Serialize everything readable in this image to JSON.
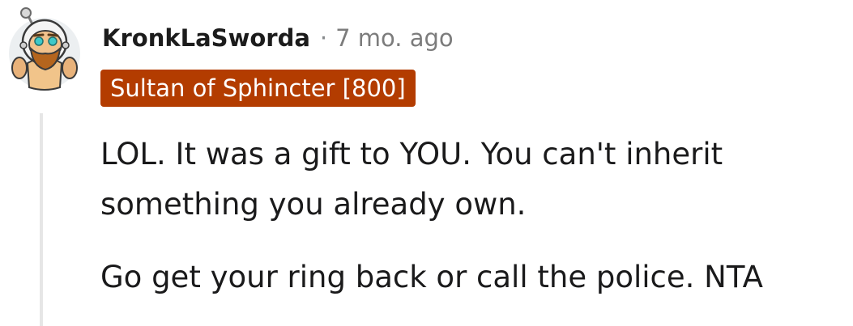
{
  "comment": {
    "author": "KronkLaSworda",
    "separator": "·",
    "timestamp": "7 mo. ago",
    "flair": "Sultan of Sphincter [800]",
    "paragraphs": [
      "LOL. It was a gift to YOU. You can't inherit something you already own.",
      "Go get your ring back or call the police. NTA"
    ],
    "avatar_icon": "snoo-astronaut-avatar-icon",
    "colors": {
      "flair_background": "#b33c00",
      "flair_text": "#ffffff",
      "meta_text": "#7c7c7c",
      "thread_line": "#e6e6e6"
    }
  }
}
